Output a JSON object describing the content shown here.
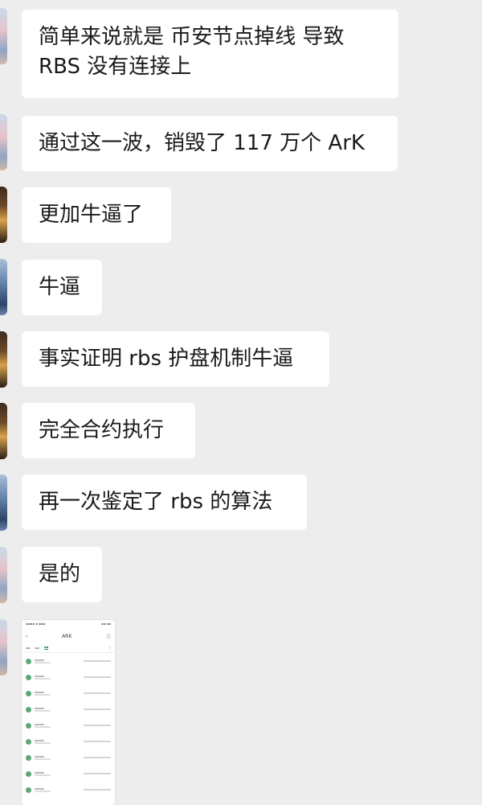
{
  "messages": [
    {
      "lines": [
        "简单来说就是 币安节点掉线 导致",
        "RBS 没有连接上"
      ]
    },
    {
      "lines": [
        "通过这一波，销毁了 117 万个 ArK"
      ]
    },
    {
      "lines": [
        "更加牛逼了"
      ]
    },
    {
      "lines": [
        "牛逼"
      ]
    },
    {
      "lines": [
        "事实证明 rbs 护盘机制牛逼"
      ]
    },
    {
      "lines": [
        "完全合约执行"
      ]
    },
    {
      "lines": [
        "再一次鉴定了 rbs 的算法"
      ]
    },
    {
      "lines": [
        "是的"
      ]
    }
  ],
  "screenshot": {
    "title": "ARK"
  }
}
